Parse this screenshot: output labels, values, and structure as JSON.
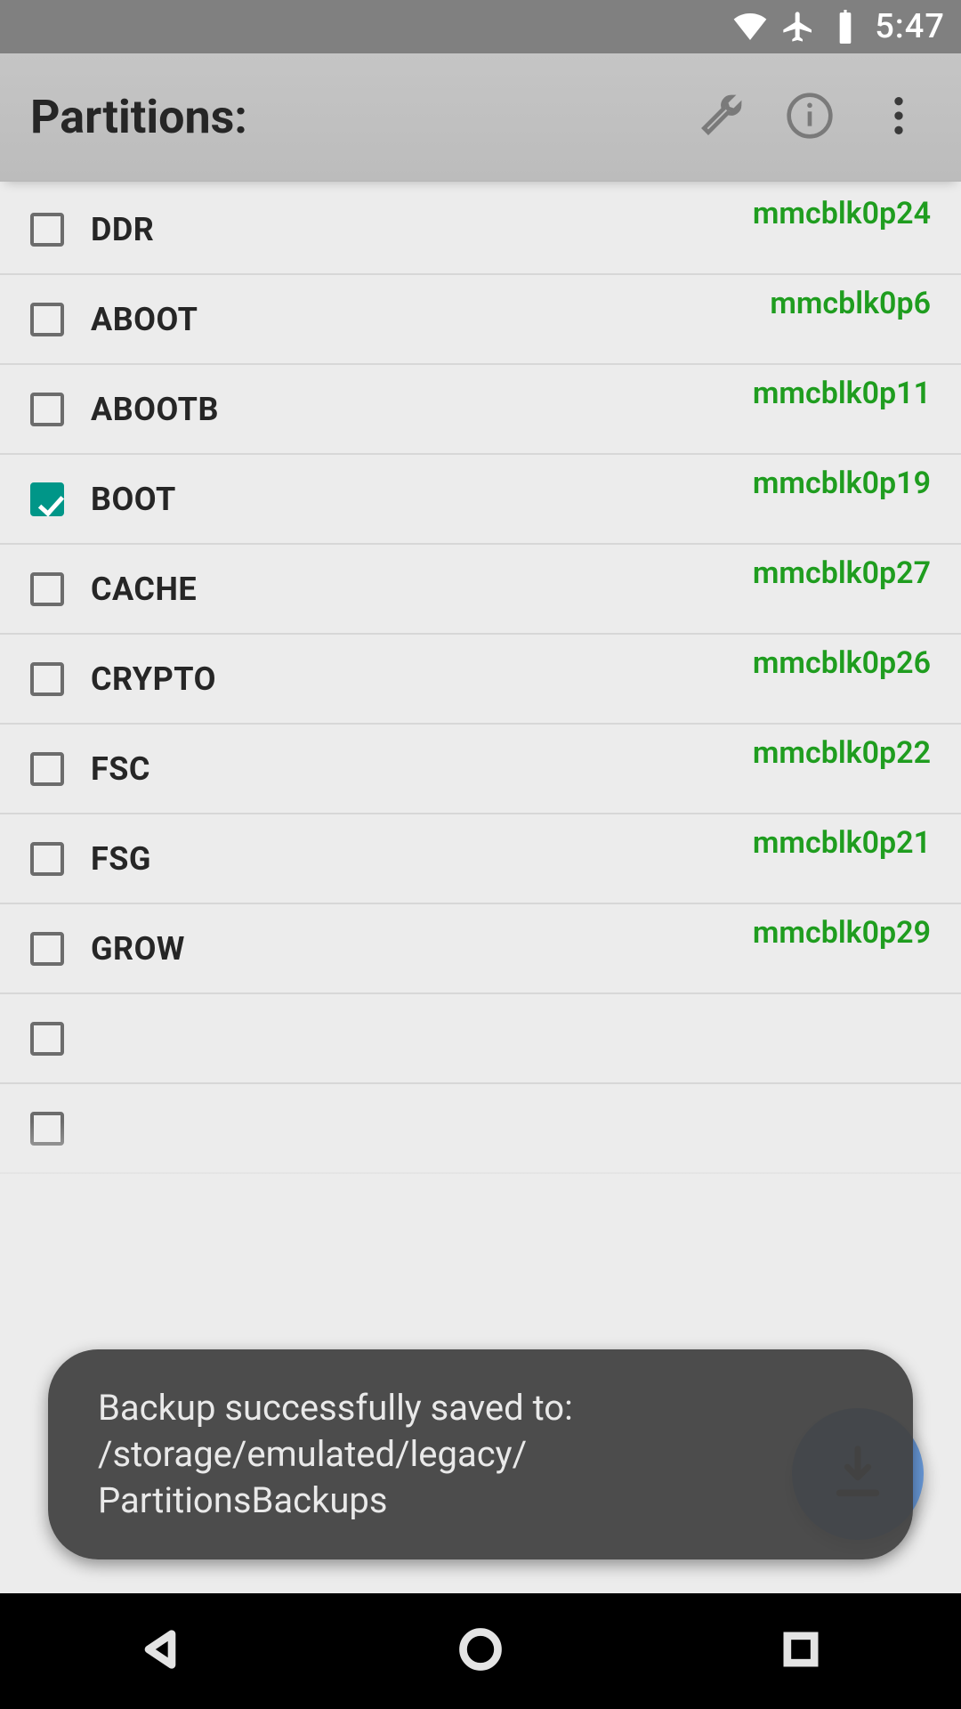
{
  "status": {
    "time": "5:47"
  },
  "app_bar": {
    "title": "Partitions:"
  },
  "partitions": [
    {
      "name": "DDR",
      "device": "mmcblk0p24",
      "checked": false
    },
    {
      "name": "ABOOT",
      "device": "mmcblk0p6",
      "checked": false
    },
    {
      "name": "ABOOTB",
      "device": "mmcblk0p11",
      "checked": false
    },
    {
      "name": "BOOT",
      "device": "mmcblk0p19",
      "checked": true
    },
    {
      "name": "CACHE",
      "device": "mmcblk0p27",
      "checked": false
    },
    {
      "name": "CRYPTO",
      "device": "mmcblk0p26",
      "checked": false
    },
    {
      "name": "FSC",
      "device": "mmcblk0p22",
      "checked": false
    },
    {
      "name": "FSG",
      "device": "mmcblk0p21",
      "checked": false
    },
    {
      "name": "GROW",
      "device": "mmcblk0p29",
      "checked": false
    },
    {
      "name": "",
      "device": "",
      "checked": false
    },
    {
      "name": "",
      "device": "",
      "checked": false
    }
  ],
  "toast": {
    "line1": "Backup successfully saved to:",
    "line2": "/storage/emulated/legacy/",
    "line3": "PartitionsBackups"
  }
}
